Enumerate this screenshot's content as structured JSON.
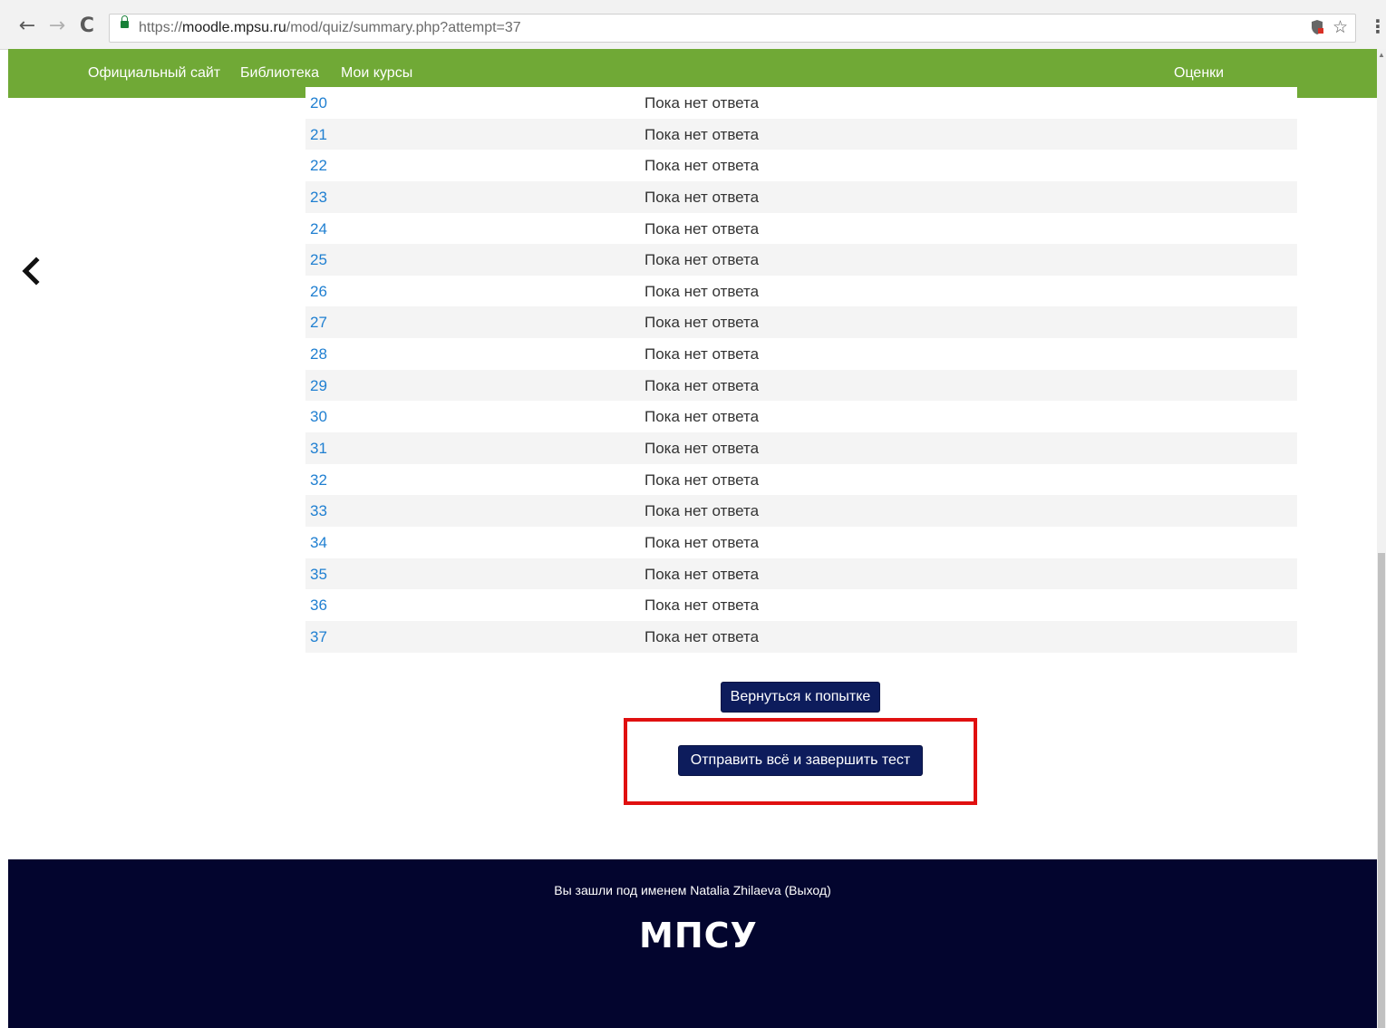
{
  "browser": {
    "url_scheme": "https://",
    "url_host": "moodle.mpsu.ru",
    "url_path": "/mod/quiz/summary.php?attempt=37",
    "back_glyph": "←",
    "forward_glyph": "→",
    "reload_glyph": "C",
    "star_glyph": "☆",
    "menu_glyph": "⋮"
  },
  "navbar": {
    "official_site": "Официальный сайт",
    "library": "Библиотека",
    "my_courses": "Мои курсы",
    "grades": "Оценки",
    "color": "#70a936"
  },
  "summary_table": {
    "rows": [
      {
        "num": "20",
        "status": "Пока нет ответа"
      },
      {
        "num": "21",
        "status": "Пока нет ответа"
      },
      {
        "num": "22",
        "status": "Пока нет ответа"
      },
      {
        "num": "23",
        "status": "Пока нет ответа"
      },
      {
        "num": "24",
        "status": "Пока нет ответа"
      },
      {
        "num": "25",
        "status": "Пока нет ответа"
      },
      {
        "num": "26",
        "status": "Пока нет ответа"
      },
      {
        "num": "27",
        "status": "Пока нет ответа"
      },
      {
        "num": "28",
        "status": "Пока нет ответа"
      },
      {
        "num": "29",
        "status": "Пока нет ответа"
      },
      {
        "num": "30",
        "status": "Пока нет ответа"
      },
      {
        "num": "31",
        "status": "Пока нет ответа"
      },
      {
        "num": "32",
        "status": "Пока нет ответа"
      },
      {
        "num": "33",
        "status": "Пока нет ответа"
      },
      {
        "num": "34",
        "status": "Пока нет ответа"
      },
      {
        "num": "35",
        "status": "Пока нет ответа"
      },
      {
        "num": "36",
        "status": "Пока нет ответа"
      },
      {
        "num": "37",
        "status": "Пока нет ответа"
      }
    ]
  },
  "actions": {
    "return_label": "Вернуться к попытке",
    "submit_label": "Отправить всё и завершить тест",
    "button_color": "#0d1c5c",
    "highlight_color": "#e01010"
  },
  "footer": {
    "login_info": "Вы зашли под именем Natalia Zhilaeva (Выход)",
    "logo_text": "МПСУ",
    "color": "#03052e"
  }
}
